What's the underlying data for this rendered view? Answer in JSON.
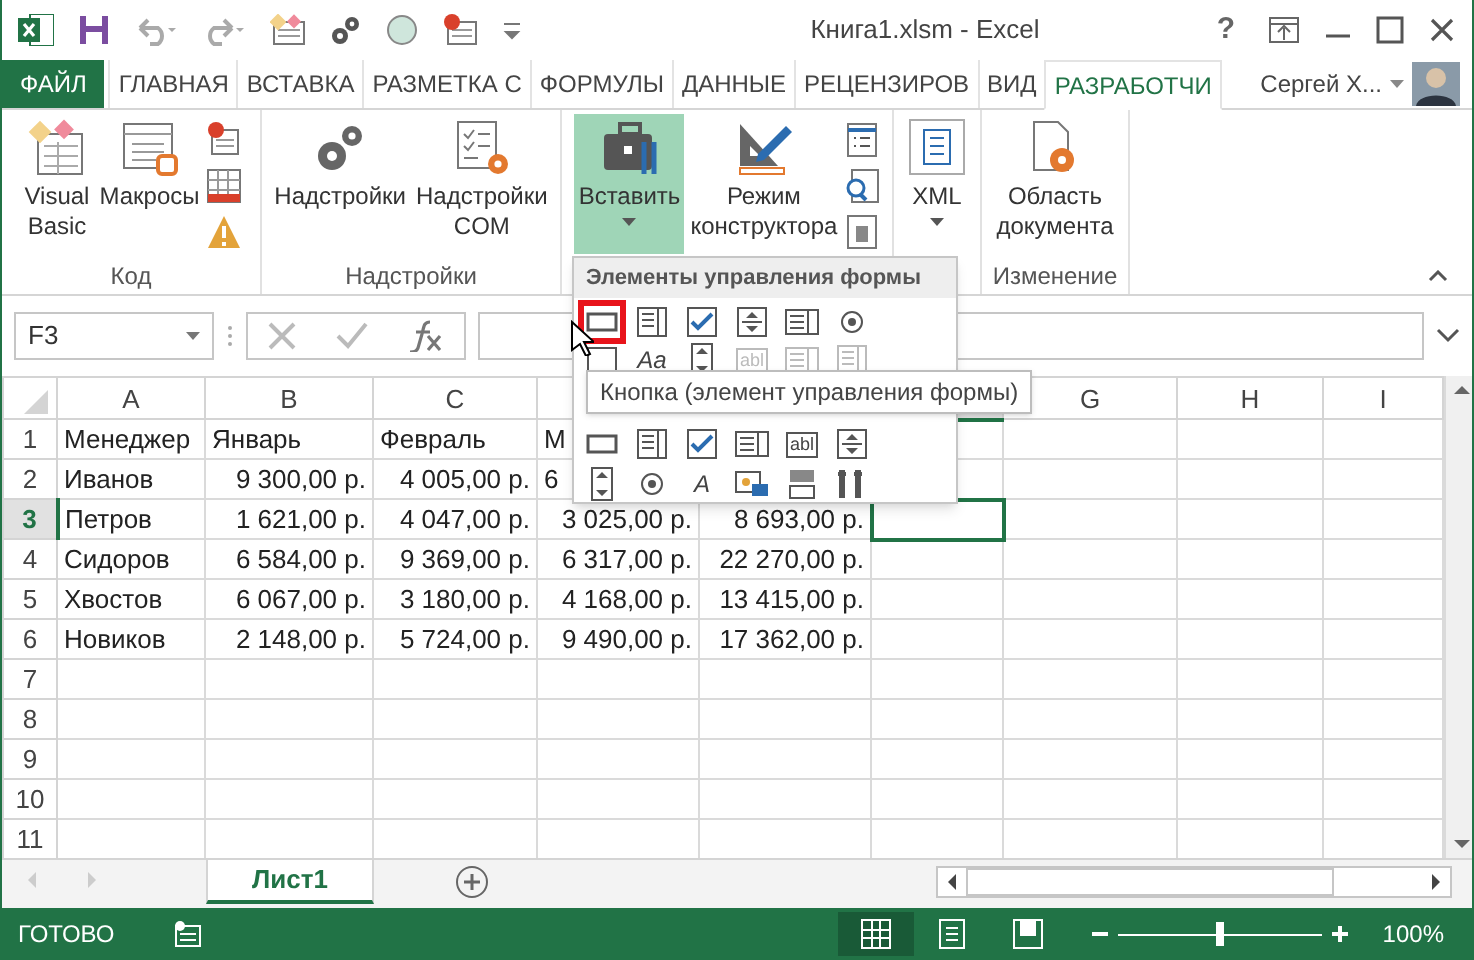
{
  "window": {
    "title": "Книга1.xlsm - Excel",
    "help": "?"
  },
  "tabs": [
    {
      "label": "ФАЙЛ",
      "kind": "file",
      "selected": false
    },
    {
      "label": "ГЛАВНАЯ",
      "kind": "tab",
      "selected": false
    },
    {
      "label": "ВСТАВКА",
      "kind": "tab",
      "selected": false
    },
    {
      "label": "РАЗМЕТКА С",
      "kind": "tab",
      "selected": false
    },
    {
      "label": "ФОРМУЛЫ",
      "kind": "tab",
      "selected": false
    },
    {
      "label": "ДАННЫЕ",
      "kind": "tab",
      "selected": false
    },
    {
      "label": "РЕЦЕНЗИРОВ",
      "kind": "tab",
      "selected": false
    },
    {
      "label": "ВИД",
      "kind": "tab",
      "selected": false
    },
    {
      "label": "РАЗРАБОТЧИ",
      "kind": "tab",
      "selected": true
    }
  ],
  "user": {
    "name": "Сергей Х..."
  },
  "ribbon": {
    "groups": [
      {
        "label": "Код",
        "buttons": [
          {
            "label": "Visual\nBasic",
            "pressed": false
          },
          {
            "label": "Макросы",
            "pressed": false
          }
        ]
      },
      {
        "label": "Надстройки",
        "buttons": [
          {
            "label": "Надстройки",
            "pressed": false
          },
          {
            "label": "Надстройки\nCOM",
            "pressed": false
          }
        ]
      },
      {
        "buttons": [
          {
            "label": "Вставить",
            "pressed": true,
            "dropdown": true
          },
          {
            "label": "Режим\nконструктора",
            "pressed": false
          }
        ]
      },
      {
        "buttons": [
          {
            "label": "XML",
            "pressed": false,
            "dropdown": true
          }
        ]
      },
      {
        "label": "Изменение",
        "buttons": [
          {
            "label": "Область\nдокумента",
            "pressed": false
          }
        ]
      }
    ]
  },
  "name_box": "F3",
  "sheet": {
    "columns": [
      {
        "label": "A",
        "selected": false
      },
      {
        "label": "B",
        "selected": false
      },
      {
        "label": "C",
        "selected": false
      },
      {},
      {},
      {
        "selected": true
      },
      {
        "label": "G",
        "selected": false
      },
      {
        "label": "H",
        "selected": false
      },
      {
        "label": "I",
        "selected": false
      }
    ],
    "rows": [
      {
        "number": "1",
        "kind": "header",
        "selected": false,
        "cells": [
          "Менеджер",
          "Январь",
          "Февраль",
          {
            "text": "М",
            "kind": "partial"
          }
        ]
      },
      {
        "number": "2",
        "kind": "data",
        "selected": false,
        "cells": [
          "Иванов",
          "9 300,00 р.",
          "4 005,00 р.",
          {
            "text": "6",
            "kind": "partial"
          }
        ]
      },
      {
        "number": "3",
        "kind": "data",
        "selected": true,
        "cells": [
          "Петров",
          "1 621,00 р.",
          "4 047,00 р.",
          "3 025,00 р.",
          "8 693,00 р."
        ]
      },
      {
        "number": "4",
        "kind": "data",
        "selected": false,
        "cells": [
          "Сидоров",
          "6 584,00 р.",
          "9 369,00 р.",
          "6 317,00 р.",
          "22 270,00 р."
        ]
      },
      {
        "number": "5",
        "kind": "data",
        "selected": false,
        "cells": [
          "Хвостов",
          "6 067,00 р.",
          "3 180,00 р.",
          "4 168,00 р.",
          "13 415,00 р."
        ]
      },
      {
        "number": "6",
        "kind": "data",
        "selected": false,
        "cells": [
          "Новиков",
          "2 148,00 р.",
          "5 724,00 р.",
          "9 490,00 р.",
          "17 362,00 р."
        ]
      },
      {
        "number": "7",
        "selected": false
      },
      {
        "number": "8",
        "selected": false
      },
      {
        "number": "9",
        "selected": false
      },
      {
        "number": "10",
        "selected": false
      },
      {
        "number": "11",
        "selected": false
      }
    ]
  },
  "insert_menu": {
    "title": "Элементы управления формы",
    "form_rows": [
      [
        {
          "kind": "button",
          "highlighted": true
        },
        {
          "kind": "combo",
          "highlighted": false
        },
        {
          "kind": "check",
          "highlighted": false
        },
        {
          "kind": "spin",
          "highlighted": false
        },
        {
          "kind": "list",
          "highlighted": false
        },
        {
          "kind": "radio",
          "highlighted": false
        }
      ],
      [
        {
          "kind": "group",
          "highlighted": false
        },
        {
          "kind": "label",
          "text": "Aa",
          "highlighted": false
        },
        {
          "kind": "scroll",
          "highlighted": false
        },
        {
          "kind": "textfield",
          "text": "abl",
          "disabled": true,
          "highlighted": false
        },
        {
          "kind": "list",
          "disabled": true,
          "highlighted": false
        },
        {
          "kind": "combo",
          "disabled": true,
          "highlighted": false
        }
      ]
    ],
    "activex_rows": [
      [
        {
          "kind": "button",
          "highlighted": false
        },
        {
          "kind": "combo",
          "highlighted": false
        },
        {
          "kind": "check",
          "highlighted": false
        },
        {
          "kind": "list",
          "highlighted": false
        },
        {
          "kind": "textfield",
          "text": "abl",
          "highlighted": false
        },
        {
          "kind": "spin",
          "highlighted": false
        }
      ],
      [
        {
          "kind": "scroll",
          "highlighted": false
        },
        {
          "kind": "radio",
          "highlighted": false
        },
        {
          "kind": "label",
          "text": "A",
          "highlighted": false
        },
        {
          "kind": "image",
          "highlighted": false
        },
        {
          "kind": "toggle",
          "highlighted": false
        },
        {
          "kind": "more",
          "highlighted": false
        }
      ]
    ],
    "tooltip": "Кнопка (элемент управления формы)"
  },
  "sheet_tabs": [
    {
      "label": "Лист1",
      "selected": true
    }
  ],
  "status_bar": {
    "status": "ГОТОВО",
    "views": [
      {
        "kind": "normal",
        "selected": true
      },
      {
        "kind": "layout",
        "selected": false
      },
      {
        "kind": "pagebreak",
        "selected": false
      }
    ],
    "zoom": {
      "level": 0.5,
      "reading": "100%"
    }
  }
}
